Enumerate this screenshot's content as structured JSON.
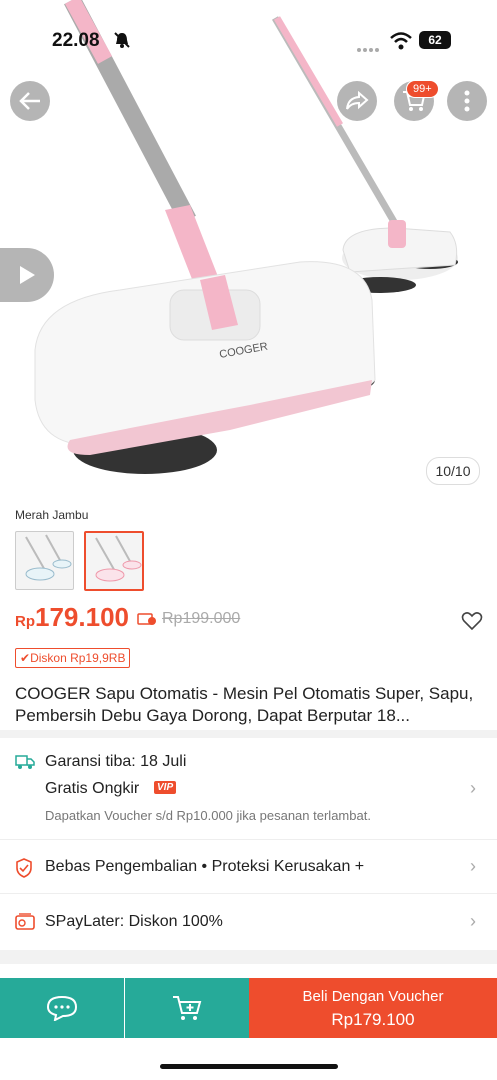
{
  "status": {
    "time": "22.08",
    "battery": "62"
  },
  "header": {
    "cart_badge": "99+"
  },
  "gallery": {
    "counter": "10/10"
  },
  "product": {
    "variant_label": "Merah Jambu",
    "price_currency": "Rp",
    "price_value": "179.100",
    "original_price": "Rp199.000",
    "discount_tag": "Diskon Rp19,9RB",
    "title": "COOGER Sapu Otomatis - Mesin Pel Otomatis Super, Sapu, Pembersih Debu Gaya Dorong, Dapat Berputar 18..."
  },
  "shipping": {
    "arrival": "Garansi tiba: 18 Juli",
    "free_shipping": "Gratis Ongkir",
    "vip": "VIP",
    "voucher_note": "Dapatkan Voucher s/d Rp10.000 jika pesanan terlambat."
  },
  "services": {
    "text": "Bebas Pengembalian  •  Proteksi Kerusakan +"
  },
  "paylater": {
    "text": "SPayLater: Diskon 100%"
  },
  "bottom": {
    "buy_line1": "Beli Dengan Voucher",
    "buy_line2": "Rp179.100"
  },
  "colors": {
    "accent": "#ee4d2d",
    "teal": "#26aa99",
    "pink": "#f4b6c8"
  }
}
